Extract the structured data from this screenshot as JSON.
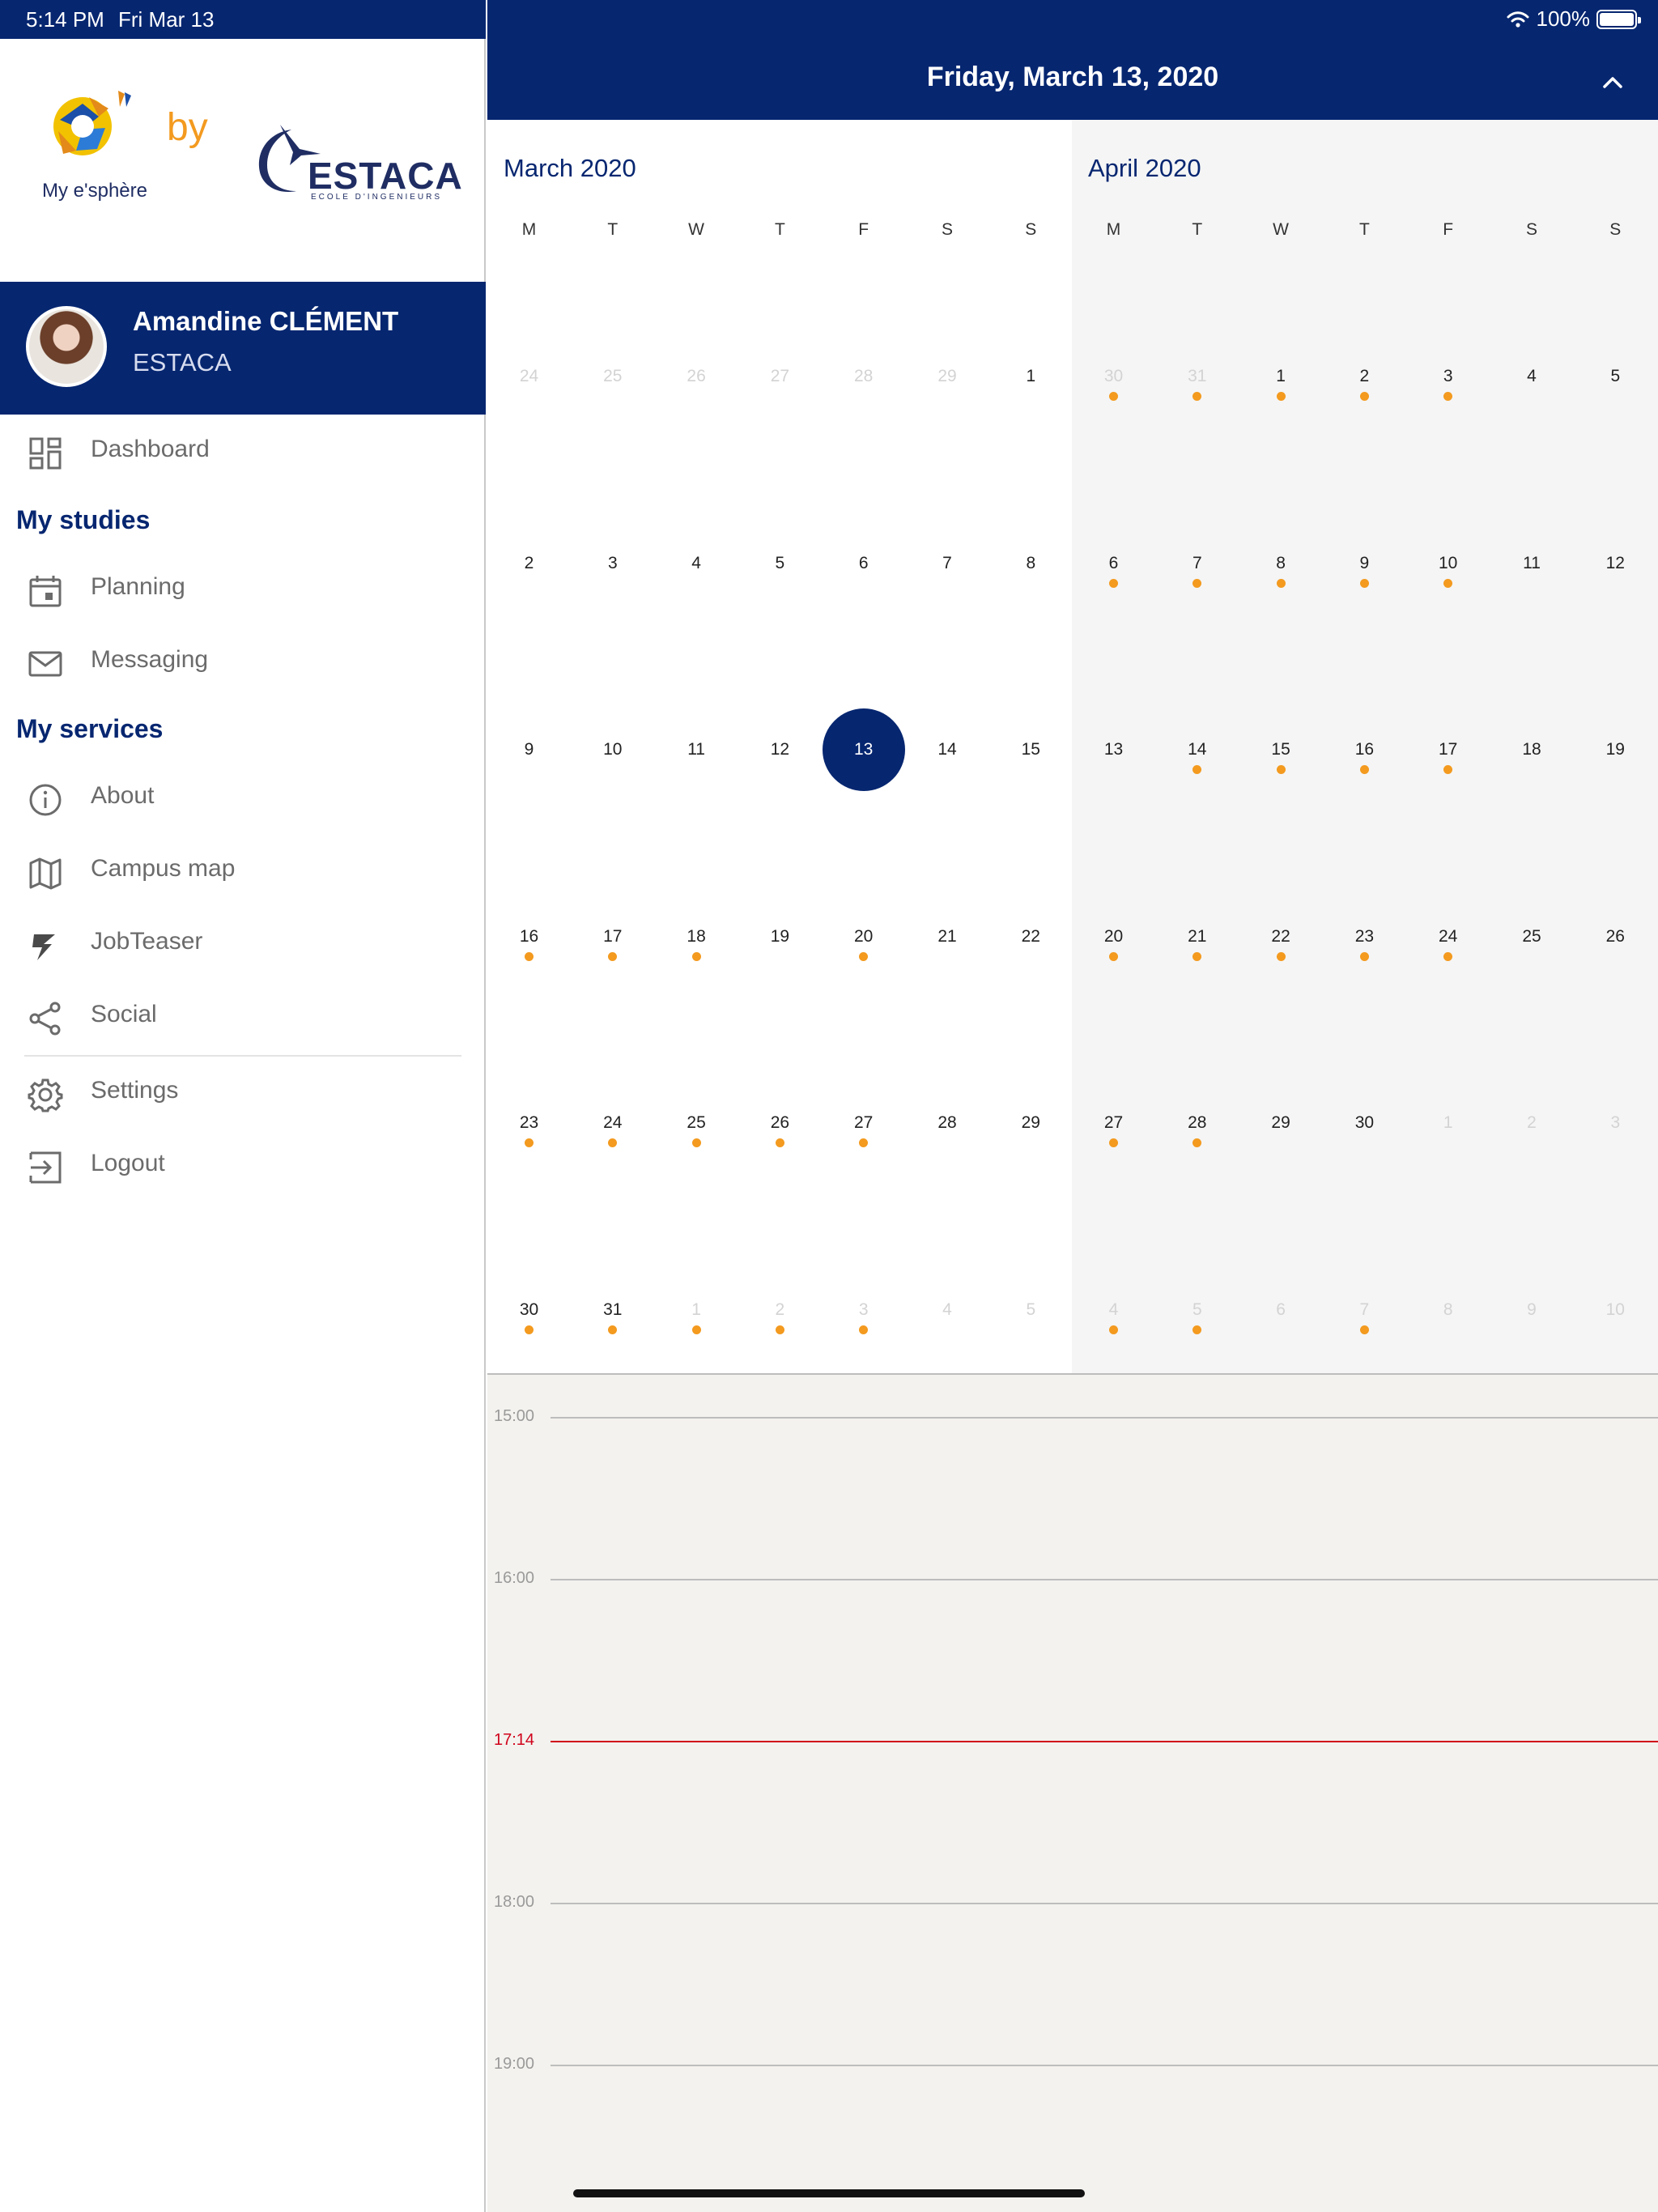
{
  "status_bar": {
    "time": "5:14 PM",
    "date": "Fri Mar 13",
    "battery": "100%"
  },
  "branding": {
    "app_name": "My e'sphère",
    "connector": "by",
    "school": "ESTACA",
    "school_subtitle": "ECOLE D'INGENIEURS"
  },
  "profile": {
    "name": "Amandine CLÉMENT",
    "organization": "ESTACA"
  },
  "menu": {
    "dashboard": "Dashboard",
    "section_studies": "My studies",
    "planning": "Planning",
    "messaging": "Messaging",
    "section_services": "My services",
    "about": "About",
    "campus_map": "Campus map",
    "jobteaser": "JobTeaser",
    "social": "Social",
    "settings": "Settings",
    "logout": "Logout"
  },
  "header": {
    "selected_date": "Friday, March 13, 2020"
  },
  "calendar": {
    "weekdays": [
      "M",
      "T",
      "W",
      "T",
      "F",
      "S",
      "S"
    ],
    "months": [
      {
        "title": "March 2020",
        "weeks": [
          [
            {
              "d": "24",
              "m": 1
            },
            {
              "d": "25",
              "m": 1
            },
            {
              "d": "26",
              "m": 1
            },
            {
              "d": "27",
              "m": 1
            },
            {
              "d": "28",
              "m": 1
            },
            {
              "d": "29",
              "m": 1
            },
            {
              "d": "1"
            }
          ],
          [
            {
              "d": "2"
            },
            {
              "d": "3"
            },
            {
              "d": "4"
            },
            {
              "d": "5"
            },
            {
              "d": "6"
            },
            {
              "d": "7"
            },
            {
              "d": "8"
            }
          ],
          [
            {
              "d": "9"
            },
            {
              "d": "10"
            },
            {
              "d": "11"
            },
            {
              "d": "12"
            },
            {
              "d": "13",
              "sel": 1
            },
            {
              "d": "14"
            },
            {
              "d": "15"
            }
          ],
          [
            {
              "d": "16",
              "e": 1
            },
            {
              "d": "17",
              "e": 1
            },
            {
              "d": "18",
              "e": 1
            },
            {
              "d": "19"
            },
            {
              "d": "20",
              "e": 1
            },
            {
              "d": "21"
            },
            {
              "d": "22"
            }
          ],
          [
            {
              "d": "23",
              "e": 1
            },
            {
              "d": "24",
              "e": 1
            },
            {
              "d": "25",
              "e": 1
            },
            {
              "d": "26",
              "e": 1
            },
            {
              "d": "27",
              "e": 1
            },
            {
              "d": "28"
            },
            {
              "d": "29"
            }
          ],
          [
            {
              "d": "30",
              "e": 1
            },
            {
              "d": "31",
              "e": 1
            },
            {
              "d": "1",
              "m": 1,
              "e": 1
            },
            {
              "d": "2",
              "m": 1,
              "e": 1
            },
            {
              "d": "3",
              "m": 1,
              "e": 1
            },
            {
              "d": "4",
              "m": 1
            },
            {
              "d": "5",
              "m": 1
            }
          ]
        ]
      },
      {
        "title": "April 2020",
        "weeks": [
          [
            {
              "d": "30",
              "m": 1,
              "e": 1
            },
            {
              "d": "31",
              "m": 1,
              "e": 1
            },
            {
              "d": "1",
              "e": 1
            },
            {
              "d": "2",
              "e": 1
            },
            {
              "d": "3",
              "e": 1
            },
            {
              "d": "4"
            },
            {
              "d": "5"
            }
          ],
          [
            {
              "d": "6",
              "e": 1
            },
            {
              "d": "7",
              "e": 1
            },
            {
              "d": "8",
              "e": 1
            },
            {
              "d": "9",
              "e": 1
            },
            {
              "d": "10",
              "e": 1
            },
            {
              "d": "11"
            },
            {
              "d": "12"
            }
          ],
          [
            {
              "d": "13"
            },
            {
              "d": "14",
              "e": 1
            },
            {
              "d": "15",
              "e": 1
            },
            {
              "d": "16",
              "e": 1
            },
            {
              "d": "17",
              "e": 1
            },
            {
              "d": "18"
            },
            {
              "d": "19"
            }
          ],
          [
            {
              "d": "20",
              "e": 1
            },
            {
              "d": "21",
              "e": 1
            },
            {
              "d": "22",
              "e": 1
            },
            {
              "d": "23",
              "e": 1
            },
            {
              "d": "24",
              "e": 1
            },
            {
              "d": "25"
            },
            {
              "d": "26"
            }
          ],
          [
            {
              "d": "27",
              "e": 1
            },
            {
              "d": "28",
              "e": 1
            },
            {
              "d": "29"
            },
            {
              "d": "30"
            },
            {
              "d": "1",
              "m": 1
            },
            {
              "d": "2",
              "m": 1
            },
            {
              "d": "3",
              "m": 1
            }
          ],
          [
            {
              "d": "4",
              "m": 1,
              "e": 1
            },
            {
              "d": "5",
              "m": 1,
              "e": 1
            },
            {
              "d": "6",
              "m": 1
            },
            {
              "d": "7",
              "m": 1,
              "e": 1
            },
            {
              "d": "8",
              "m": 1
            },
            {
              "d": "9",
              "m": 1
            },
            {
              "d": "10",
              "m": 1
            }
          ]
        ]
      }
    ]
  },
  "timeline": {
    "rows": [
      {
        "label": "15:00",
        "now": false
      },
      {
        "label": "16:00",
        "now": false
      },
      {
        "label": "17:14",
        "now": true
      },
      {
        "label": "18:00",
        "now": false
      },
      {
        "label": "19:00",
        "now": false
      }
    ]
  },
  "colors": {
    "primary": "#062670",
    "accent": "#f39a1f",
    "now_line": "#d0021b"
  }
}
